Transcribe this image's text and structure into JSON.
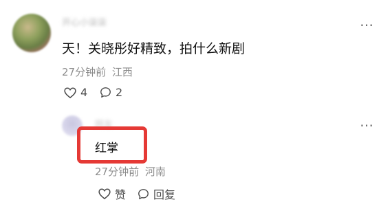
{
  "comment": {
    "username": "开心小柒柒",
    "text": "天！关晓彤好精致，拍什么新剧",
    "time": "27分钟前",
    "location": "江西",
    "like_count": "4",
    "reply_count": "2",
    "more_icon": "more-horizontal-icon"
  },
  "reply": {
    "username": "网友",
    "text": "红掌",
    "time": "27分钟前",
    "location": "河南",
    "like_label": "赞",
    "reply_label": "回复",
    "more_icon": "more-horizontal-icon"
  },
  "colors": {
    "highlight_border": "#e53935",
    "meta_text": "#8c8c8c"
  }
}
